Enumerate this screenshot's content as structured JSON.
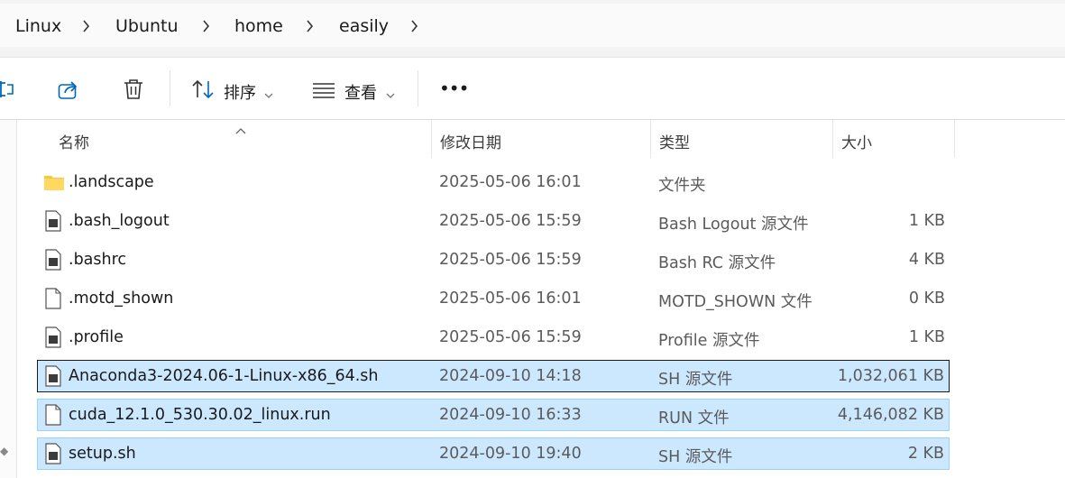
{
  "breadcrumb": [
    "Linux",
    "Ubuntu",
    "home",
    "easily"
  ],
  "toolbar": {
    "sort_label": "排序",
    "view_label": "查看",
    "more_label": "•••"
  },
  "columns": {
    "name": "名称",
    "modified": "修改日期",
    "type": "类型",
    "size": "大小"
  },
  "files": [
    {
      "name": ".landscape",
      "modified": "2025-05-06 16:01",
      "type": "文件夹",
      "size": "",
      "icon": "folder-icon",
      "selected": false
    },
    {
      "name": ".bash_logout",
      "modified": "2025-05-06 15:59",
      "type": "Bash Logout 源文件",
      "size": "1 KB",
      "icon": "script-file-icon",
      "selected": false
    },
    {
      "name": ".bashrc",
      "modified": "2025-05-06 15:59",
      "type": "Bash RC 源文件",
      "size": "4 KB",
      "icon": "script-file-icon",
      "selected": false
    },
    {
      "name": ".motd_shown",
      "modified": "2025-05-06 16:01",
      "type": "MOTD_SHOWN 文件",
      "size": "0 KB",
      "icon": "blank-file-icon",
      "selected": false
    },
    {
      "name": ".profile",
      "modified": "2025-05-06 15:59",
      "type": "Profile 源文件",
      "size": "1 KB",
      "icon": "script-file-icon",
      "selected": false
    },
    {
      "name": "Anaconda3-2024.06-1-Linux-x86_64.sh",
      "modified": "2024-09-10 14:18",
      "type": "SH 源文件",
      "size": "1,032,061 KB",
      "icon": "script-file-icon",
      "selected": true
    },
    {
      "name": "cuda_12.1.0_530.30.02_linux.run",
      "modified": "2024-09-10 16:33",
      "type": "RUN 文件",
      "size": "4,146,082 KB",
      "icon": "blank-file-icon",
      "selected": true
    },
    {
      "name": "setup.sh",
      "modified": "2024-09-10 19:40",
      "type": "SH 源文件",
      "size": "2 KB",
      "icon": "script-file-icon",
      "selected": true
    }
  ],
  "colors": {
    "selection_bg": "#cce8ff",
    "selection_border": "#99d1ff",
    "accent": "#0067c0",
    "folder": "#f8c63f"
  }
}
